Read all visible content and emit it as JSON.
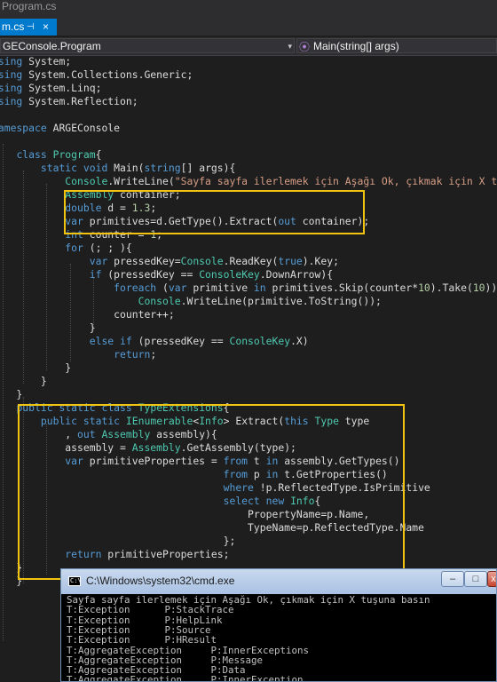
{
  "window": {
    "title": "Program.cs"
  },
  "tab": {
    "label": "m.cs",
    "pin_glyph": "⊣",
    "close_glyph": "×"
  },
  "nav": {
    "left_label": "GEConsole.Program",
    "right_label": "Main(string[] args)",
    "dropdown_glyph": "▾",
    "method_glyph": "⦿"
  },
  "code": {
    "lines": [
      {
        "segments": [
          {
            "t": "using",
            "c": "kw"
          },
          {
            "t": " System;",
            "c": "tx"
          }
        ]
      },
      {
        "segments": [
          {
            "t": "using",
            "c": "kw"
          },
          {
            "t": " System.Collections.Generic;",
            "c": "tx"
          }
        ]
      },
      {
        "segments": [
          {
            "t": "using",
            "c": "kw"
          },
          {
            "t": " System.Linq;",
            "c": "tx"
          }
        ]
      },
      {
        "segments": [
          {
            "t": "using",
            "c": "kw"
          },
          {
            "t": " System.Reflection;",
            "c": "tx"
          }
        ]
      },
      {
        "segments": []
      },
      {
        "segments": [
          {
            "t": "namespace",
            "c": "kw"
          },
          {
            "t": " ARGEConsole",
            "c": "tx"
          }
        ]
      },
      {
        "segments": [
          {
            "t": "{",
            "c": "tx"
          }
        ]
      },
      {
        "segments": [
          {
            "t": "    ",
            "c": "tx"
          },
          {
            "t": "class",
            "c": "kw"
          },
          {
            "t": " ",
            "c": "tx"
          },
          {
            "t": "Program",
            "c": "ty"
          },
          {
            "t": "{",
            "c": "tx"
          }
        ]
      },
      {
        "segments": [
          {
            "t": "        ",
            "c": "tx"
          },
          {
            "t": "static",
            "c": "kw"
          },
          {
            "t": " ",
            "c": "tx"
          },
          {
            "t": "void",
            "c": "kw"
          },
          {
            "t": " Main(",
            "c": "tx"
          },
          {
            "t": "string",
            "c": "kw"
          },
          {
            "t": "[] args){",
            "c": "tx"
          }
        ]
      },
      {
        "segments": [
          {
            "t": "            ",
            "c": "tx"
          },
          {
            "t": "Console",
            "c": "ty"
          },
          {
            "t": ".WriteLine(",
            "c": "tx"
          },
          {
            "t": "\"Sayfa sayfa ilerlemek için Aşağı Ok, çıkmak için X tuşu",
            "c": "st"
          }
        ]
      },
      {
        "segments": [
          {
            "t": "            ",
            "c": "tx"
          },
          {
            "t": "Assembly",
            "c": "ty"
          },
          {
            "t": " container;",
            "c": "tx"
          }
        ]
      },
      {
        "segments": [
          {
            "t": "            ",
            "c": "tx"
          },
          {
            "t": "double",
            "c": "kw"
          },
          {
            "t": " d = ",
            "c": "tx"
          },
          {
            "t": "1.3",
            "c": "nm"
          },
          {
            "t": ";",
            "c": "tx"
          }
        ]
      },
      {
        "segments": [
          {
            "t": "            ",
            "c": "tx"
          },
          {
            "t": "var",
            "c": "kw"
          },
          {
            "t": " primitives=d.GetType().Extract(",
            "c": "tx"
          },
          {
            "t": "out",
            "c": "kw"
          },
          {
            "t": " container);",
            "c": "tx"
          }
        ]
      },
      {
        "segments": [
          {
            "t": "            ",
            "c": "tx"
          },
          {
            "t": "int",
            "c": "kw"
          },
          {
            "t": " counter = ",
            "c": "tx"
          },
          {
            "t": "1",
            "c": "nm"
          },
          {
            "t": ";",
            "c": "tx"
          }
        ]
      },
      {
        "segments": [
          {
            "t": "            ",
            "c": "tx"
          },
          {
            "t": "for",
            "c": "kw"
          },
          {
            "t": " (; ; ){",
            "c": "tx"
          }
        ]
      },
      {
        "segments": [
          {
            "t": "                ",
            "c": "tx"
          },
          {
            "t": "var",
            "c": "kw"
          },
          {
            "t": " pressedKey=",
            "c": "tx"
          },
          {
            "t": "Console",
            "c": "ty"
          },
          {
            "t": ".ReadKey(",
            "c": "tx"
          },
          {
            "t": "true",
            "c": "kw"
          },
          {
            "t": ").Key;",
            "c": "tx"
          }
        ]
      },
      {
        "segments": [
          {
            "t": "                ",
            "c": "tx"
          },
          {
            "t": "if",
            "c": "kw"
          },
          {
            "t": " (pressedKey == ",
            "c": "tx"
          },
          {
            "t": "ConsoleKey",
            "c": "ty"
          },
          {
            "t": ".DownArrow){",
            "c": "tx"
          }
        ]
      },
      {
        "segments": [
          {
            "t": "                    ",
            "c": "tx"
          },
          {
            "t": "foreach",
            "c": "kw"
          },
          {
            "t": " (",
            "c": "tx"
          },
          {
            "t": "var",
            "c": "kw"
          },
          {
            "t": " primitive ",
            "c": "tx"
          },
          {
            "t": "in",
            "c": "kw"
          },
          {
            "t": " primitives.Skip(counter*",
            "c": "tx"
          },
          {
            "t": "10",
            "c": "nm"
          },
          {
            "t": ").Take(",
            "c": "tx"
          },
          {
            "t": "10",
            "c": "nm"
          },
          {
            "t": "))",
            "c": "tx"
          }
        ]
      },
      {
        "segments": [
          {
            "t": "                        ",
            "c": "tx"
          },
          {
            "t": "Console",
            "c": "ty"
          },
          {
            "t": ".WriteLine(primitive.ToString());",
            "c": "tx"
          }
        ]
      },
      {
        "segments": [
          {
            "t": "                    counter++;",
            "c": "tx"
          }
        ]
      },
      {
        "segments": [
          {
            "t": "                }",
            "c": "tx"
          }
        ]
      },
      {
        "segments": [
          {
            "t": "                ",
            "c": "tx"
          },
          {
            "t": "else",
            "c": "kw"
          },
          {
            "t": " ",
            "c": "tx"
          },
          {
            "t": "if",
            "c": "kw"
          },
          {
            "t": " (pressedKey == ",
            "c": "tx"
          },
          {
            "t": "ConsoleKey",
            "c": "ty"
          },
          {
            "t": ".X)",
            "c": "tx"
          }
        ]
      },
      {
        "segments": [
          {
            "t": "                    ",
            "c": "tx"
          },
          {
            "t": "return",
            "c": "kw"
          },
          {
            "t": ";",
            "c": "tx"
          }
        ]
      },
      {
        "segments": [
          {
            "t": "            }",
            "c": "tx"
          }
        ]
      },
      {
        "segments": [
          {
            "t": "        }",
            "c": "tx"
          }
        ]
      },
      {
        "segments": [
          {
            "t": "    }",
            "c": "tx"
          }
        ]
      },
      {
        "segments": [
          {
            "t": "    ",
            "c": "tx"
          },
          {
            "t": "public",
            "c": "kw"
          },
          {
            "t": " ",
            "c": "tx"
          },
          {
            "t": "static",
            "c": "kw"
          },
          {
            "t": " ",
            "c": "tx"
          },
          {
            "t": "class",
            "c": "kw"
          },
          {
            "t": " ",
            "c": "tx"
          },
          {
            "t": "TypeExtensions",
            "c": "ty"
          },
          {
            "t": "{",
            "c": "tx"
          }
        ]
      },
      {
        "segments": [
          {
            "t": "        ",
            "c": "tx"
          },
          {
            "t": "public",
            "c": "kw"
          },
          {
            "t": " ",
            "c": "tx"
          },
          {
            "t": "static",
            "c": "kw"
          },
          {
            "t": " ",
            "c": "tx"
          },
          {
            "t": "IEnumerable",
            "c": "ty"
          },
          {
            "t": "<",
            "c": "tx"
          },
          {
            "t": "Info",
            "c": "ty"
          },
          {
            "t": "> Extract(",
            "c": "tx"
          },
          {
            "t": "this",
            "c": "kw"
          },
          {
            "t": " ",
            "c": "tx"
          },
          {
            "t": "Type",
            "c": "ty"
          },
          {
            "t": " type",
            "c": "tx"
          }
        ]
      },
      {
        "segments": [
          {
            "t": "            , ",
            "c": "tx"
          },
          {
            "t": "out",
            "c": "kw"
          },
          {
            "t": " ",
            "c": "tx"
          },
          {
            "t": "Assembly",
            "c": "ty"
          },
          {
            "t": " assembly){",
            "c": "tx"
          }
        ]
      },
      {
        "segments": [
          {
            "t": "            assembly = ",
            "c": "tx"
          },
          {
            "t": "Assembly",
            "c": "ty"
          },
          {
            "t": ".GetAssembly(type);",
            "c": "tx"
          }
        ]
      },
      {
        "segments": [
          {
            "t": "            ",
            "c": "tx"
          },
          {
            "t": "var",
            "c": "kw"
          },
          {
            "t": " primitiveProperties = ",
            "c": "tx"
          },
          {
            "t": "from",
            "c": "kw"
          },
          {
            "t": " t ",
            "c": "tx"
          },
          {
            "t": "in",
            "c": "kw"
          },
          {
            "t": " assembly.GetTypes()",
            "c": "tx"
          }
        ]
      },
      {
        "segments": [
          {
            "t": "                                      ",
            "c": "tx"
          },
          {
            "t": "from",
            "c": "kw"
          },
          {
            "t": " p ",
            "c": "tx"
          },
          {
            "t": "in",
            "c": "kw"
          },
          {
            "t": " t.GetProperties()",
            "c": "tx"
          }
        ]
      },
      {
        "segments": [
          {
            "t": "                                      ",
            "c": "tx"
          },
          {
            "t": "where",
            "c": "kw"
          },
          {
            "t": " !p.ReflectedType.IsPrimitive",
            "c": "tx"
          }
        ]
      },
      {
        "segments": [
          {
            "t": "                                      ",
            "c": "tx"
          },
          {
            "t": "select",
            "c": "kw"
          },
          {
            "t": " ",
            "c": "tx"
          },
          {
            "t": "new",
            "c": "kw"
          },
          {
            "t": " ",
            "c": "tx"
          },
          {
            "t": "Info",
            "c": "ty"
          },
          {
            "t": "{",
            "c": "tx"
          }
        ]
      },
      {
        "segments": [
          {
            "t": "                                          PropertyName=p.Name,",
            "c": "tx"
          }
        ]
      },
      {
        "segments": [
          {
            "t": "                                          TypeName=p.ReflectedType.Name",
            "c": "tx"
          }
        ]
      },
      {
        "segments": [
          {
            "t": "                                      };",
            "c": "tx"
          }
        ]
      },
      {
        "segments": [
          {
            "t": "            ",
            "c": "tx"
          },
          {
            "t": "return",
            "c": "kw"
          },
          {
            "t": " primitiveProperties;",
            "c": "tx"
          }
        ]
      },
      {
        "segments": [
          {
            "t": "    }",
            "c": "tx"
          }
        ]
      },
      {
        "segments": [
          {
            "t": "    }",
            "c": "tx"
          }
        ]
      },
      {
        "segments": [
          {
            "t": "}",
            "c": "tx"
          }
        ]
      }
    ]
  },
  "console": {
    "title": "C:\\Windows\\system32\\cmd.exe",
    "icon_text": "C:\\",
    "min_glyph": "–",
    "max_glyph": "□",
    "close_glyph": "x",
    "lines": [
      "Sayfa sayfa ilerlemek için Aşağı Ok, çıkmak için X tuşuna basın",
      "T:Exception      P:StackTrace",
      "T:Exception      P:HelpLink",
      "T:Exception      P:Source",
      "T:Exception      P:HResult",
      "T:AggregateException     P:InnerExceptions",
      "T:AggregateException     P:Message",
      "T:AggregateException     P:Data",
      "T:AggregateException     P:InnerException"
    ]
  }
}
